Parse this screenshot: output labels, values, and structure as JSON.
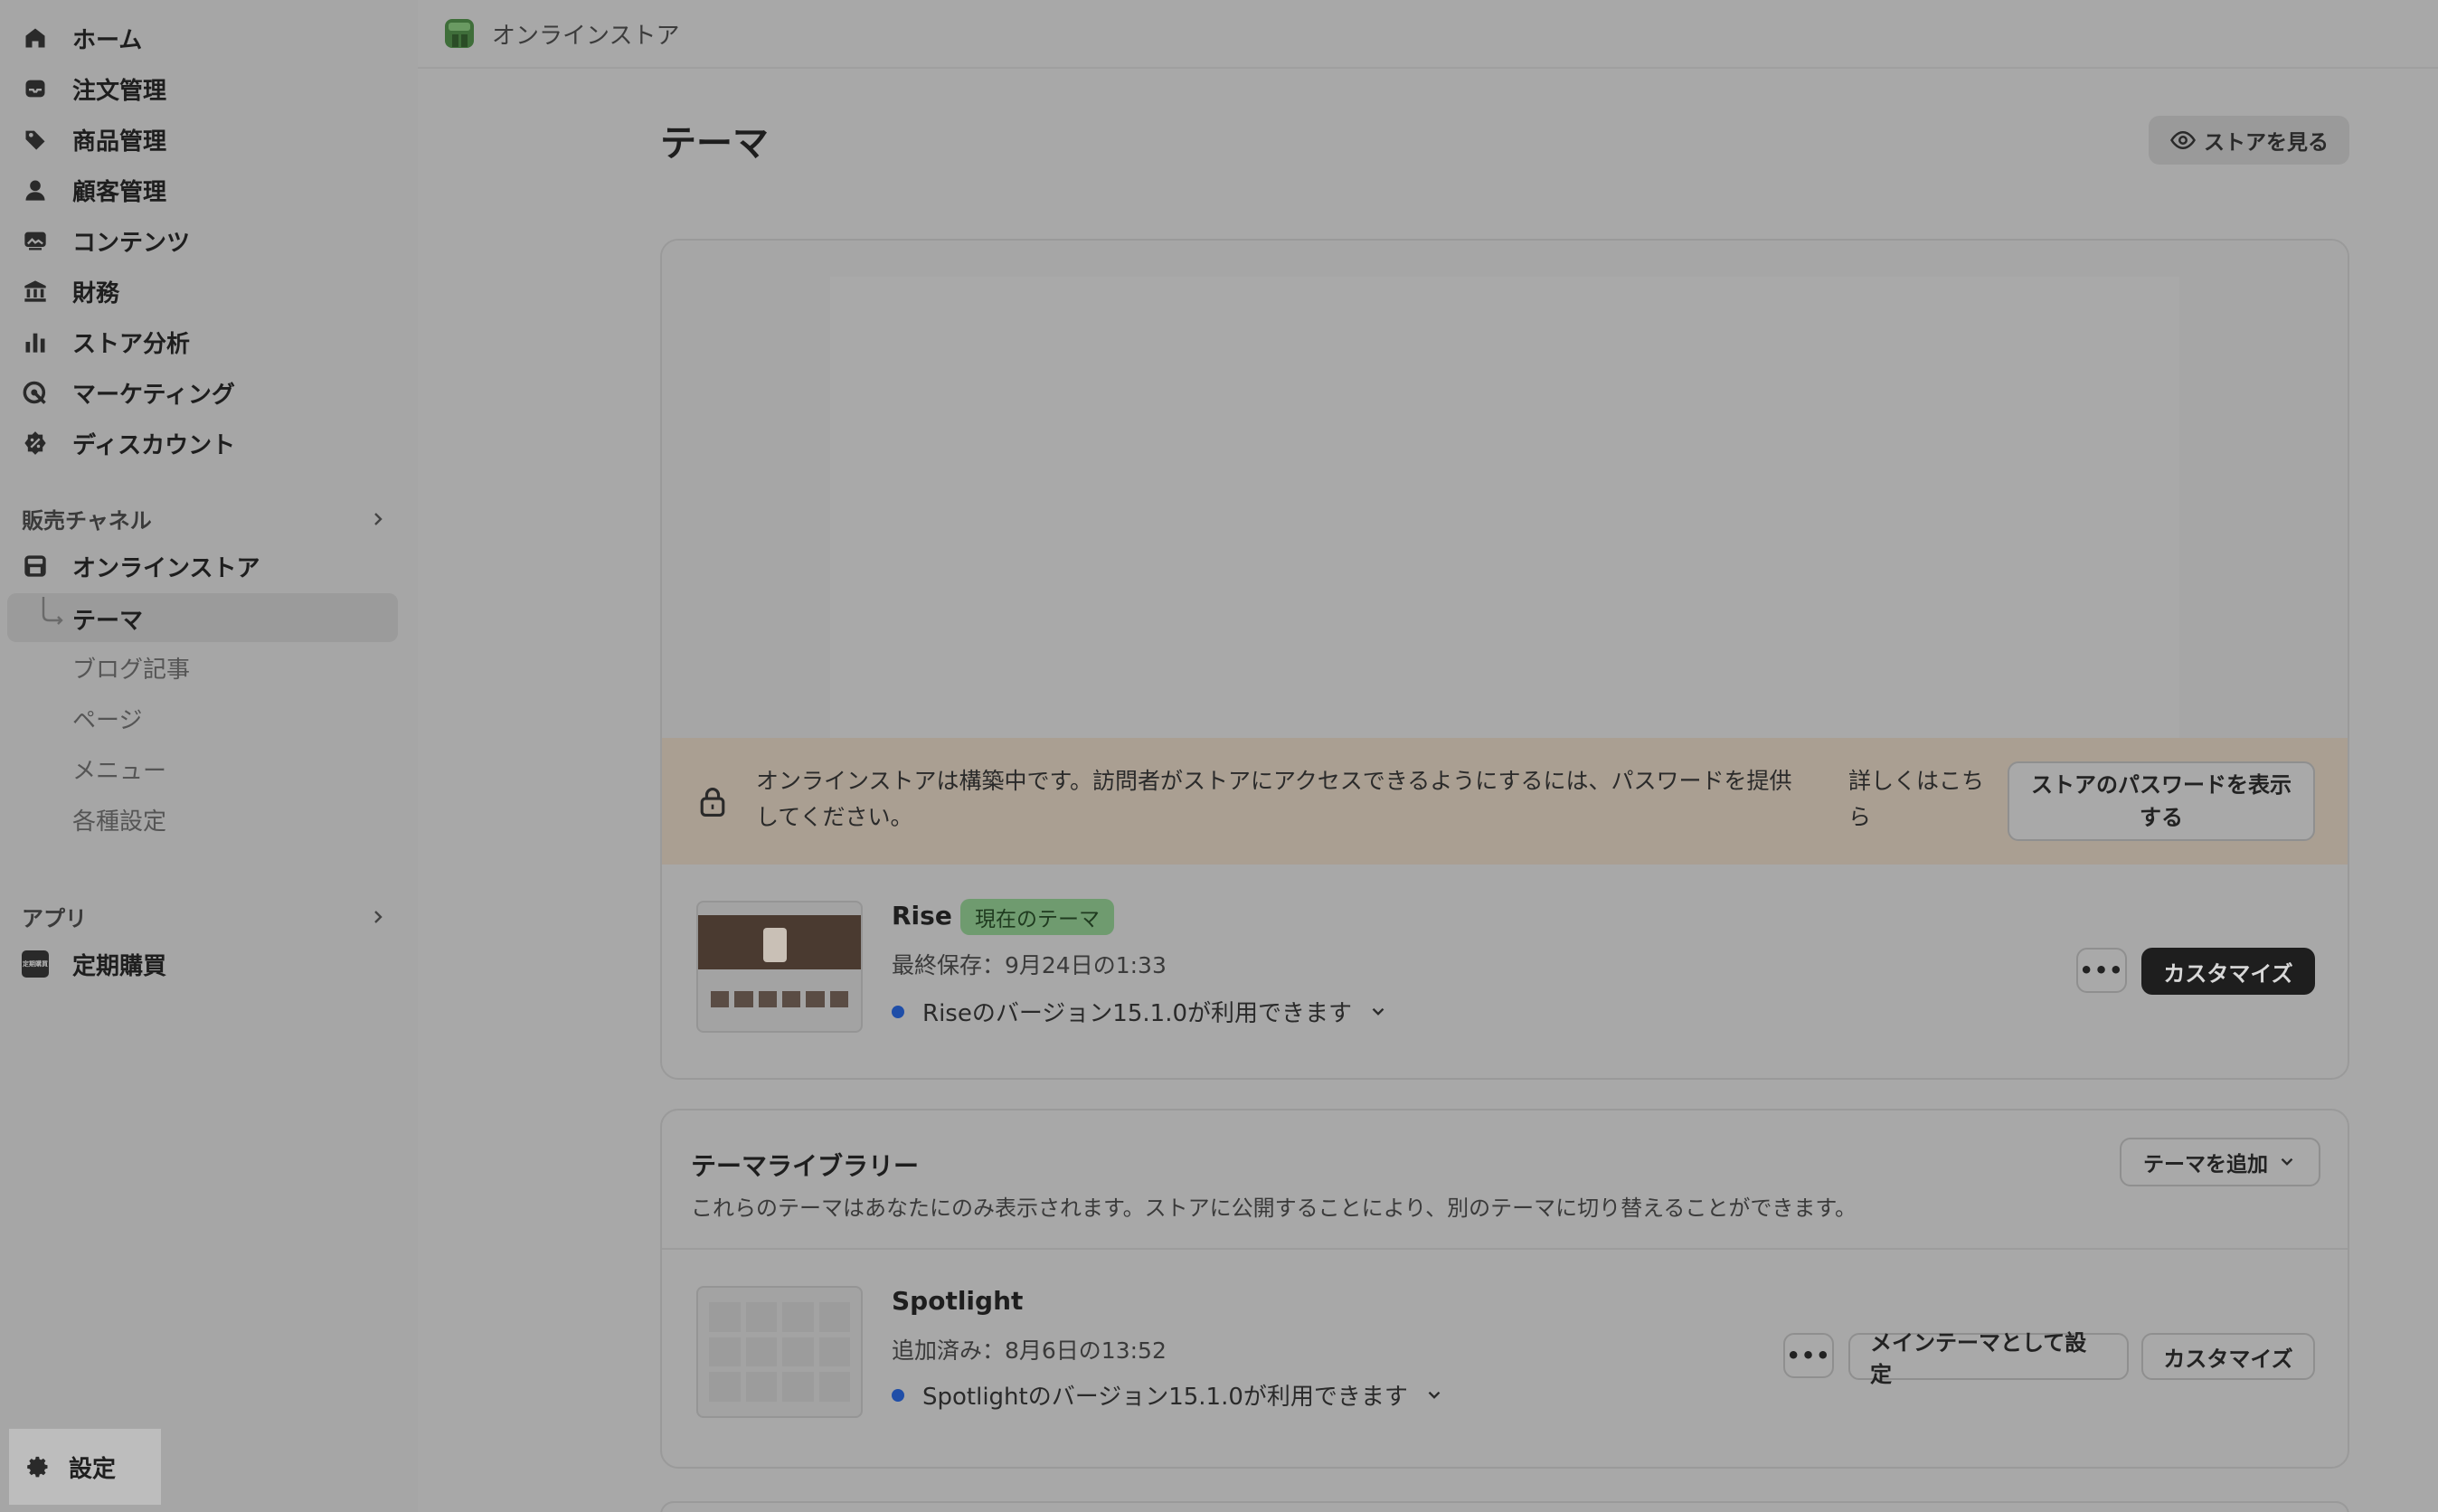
{
  "sidebar": {
    "nav": [
      {
        "label": "ホーム",
        "icon": "home-icon"
      },
      {
        "label": "注文管理",
        "icon": "inbox-icon"
      },
      {
        "label": "商品管理",
        "icon": "tag-icon"
      },
      {
        "label": "顧客管理",
        "icon": "person-icon"
      },
      {
        "label": "コンテンツ",
        "icon": "image-icon"
      },
      {
        "label": "財務",
        "icon": "bank-icon"
      },
      {
        "label": "ストア分析",
        "icon": "bar-chart-icon"
      },
      {
        "label": "マーケティング",
        "icon": "target-icon"
      },
      {
        "label": "ディスカウント",
        "icon": "discount-icon"
      }
    ],
    "sales_channels_label": "販売チャネル",
    "online_store_label": "オンラインストア",
    "sub_items": [
      "テーマ",
      "ブログ記事",
      "ページ",
      "メニュー",
      "各種設定"
    ],
    "apps_label": "アプリ",
    "app_item_label": "定期購買",
    "app_icon_text": "定期購買",
    "settings_label": "設定"
  },
  "topbar": {
    "title": "オンラインストア"
  },
  "page": {
    "title": "テーマ",
    "view_store_label": "ストアを見る"
  },
  "banner": {
    "message": "オンラインストアは構築中です。訪問者がストアにアクセスできるようにするには、パスワードを提供してください。",
    "learn_more": "詳しくはこちら",
    "button_label": "ストアのパスワードを表示する"
  },
  "current_theme": {
    "name": "Rise",
    "badge": "現在のテーマ",
    "saved": "最終保存：9月24日の1:33",
    "version": "Riseのバージョン15.1.0が利用できます",
    "more_label": "•••",
    "customize_label": "カスタマイズ"
  },
  "library": {
    "title": "テーマライブラリー",
    "description": "これらのテーマはあなたにのみ表示されます。ストアに公開することにより、別のテーマに切り替えることができます。",
    "add_theme_label": "テーマを追加",
    "themes": [
      {
        "name": "Spotlight",
        "added": "追加済み：8月6日の13:52",
        "version": "Spotlightのバージョン15.1.0が利用できます",
        "more_label": "•••",
        "publish_label": "メインテーマとして設定",
        "customize_label": "カスタマイズ"
      }
    ]
  },
  "colors": {
    "accent_green": "#6f9b6f",
    "version_dot": "#1f4ea8",
    "banner_bg": "#aa9f92"
  }
}
